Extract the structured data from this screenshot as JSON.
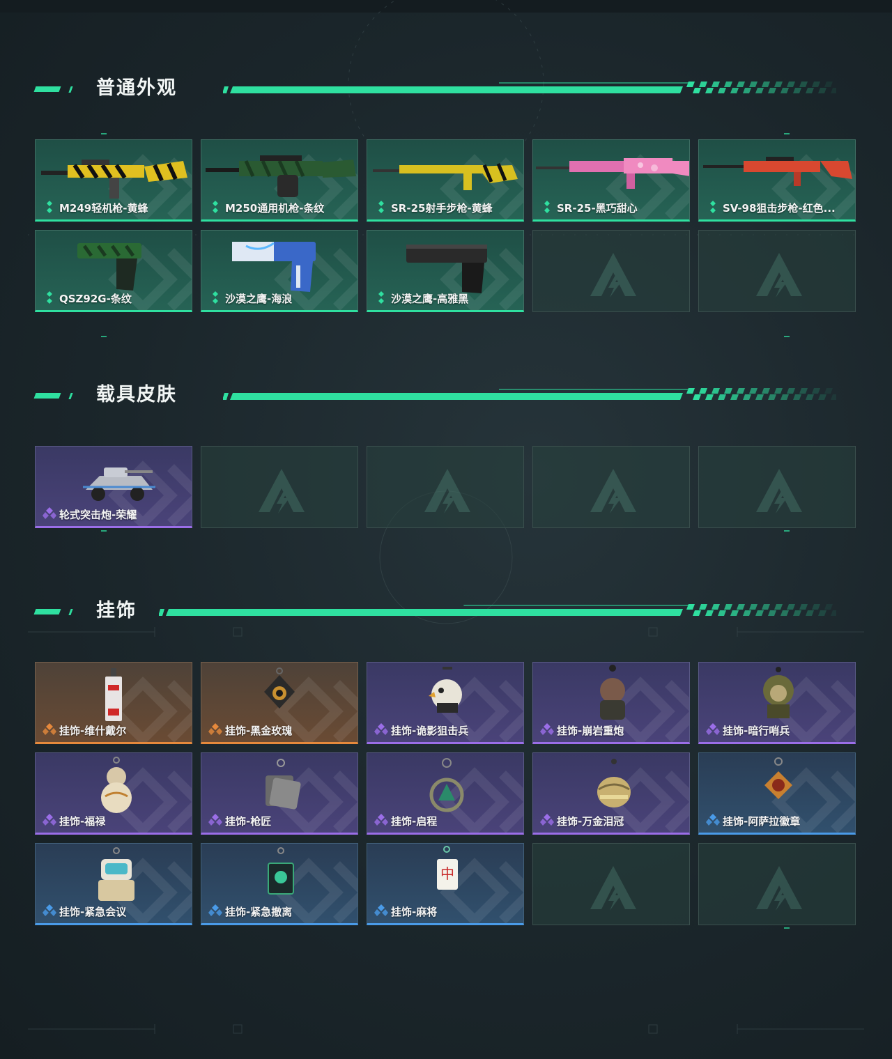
{
  "sections": [
    {
      "title": "普通外观",
      "items": [
        {
          "label": "M249轻机枪-黄蜂",
          "rarity": "green",
          "art": "rifle-yellow"
        },
        {
          "label": "M250通用机枪-条纹",
          "rarity": "green",
          "art": "mg-green"
        },
        {
          "label": "SR-25射手步枪-黄蜂",
          "rarity": "green",
          "art": "rifle-thin-yellow"
        },
        {
          "label": "SR-25-黑巧甜心",
          "rarity": "green",
          "art": "rifle-pink"
        },
        {
          "label": "SV-98狙击步枪-红色...",
          "rarity": "green",
          "art": "sniper-red"
        },
        {
          "label": "QSZ92G-条纹",
          "rarity": "green",
          "art": "pistol-green"
        },
        {
          "label": "沙漠之鹰-海浪",
          "rarity": "green",
          "art": "pistol-blue"
        },
        {
          "label": "沙漠之鹰-高雅黑",
          "rarity": "green",
          "art": "pistol-black"
        },
        {
          "label": "",
          "rarity": "empty"
        },
        {
          "label": "",
          "rarity": "empty"
        }
      ]
    },
    {
      "title": "载具皮肤",
      "items": [
        {
          "label": "轮式突击炮-荣耀",
          "rarity": "purple",
          "art": "vehicle"
        },
        {
          "label": "",
          "rarity": "empty"
        },
        {
          "label": "",
          "rarity": "empty"
        },
        {
          "label": "",
          "rarity": "empty"
        },
        {
          "label": "",
          "rarity": "empty"
        }
      ]
    },
    {
      "title": "挂饰",
      "items": [
        {
          "label": "挂饰-维什戴尔",
          "rarity": "orange",
          "art": "charm-tag"
        },
        {
          "label": "挂饰-黑金玫瑰",
          "rarity": "orange",
          "art": "charm-rose"
        },
        {
          "label": "挂饰-诡影狙击兵",
          "rarity": "purple",
          "art": "charm-bird"
        },
        {
          "label": "挂饰-崩岩重炮",
          "rarity": "purple",
          "art": "charm-figure"
        },
        {
          "label": "挂饰-暗行哨兵",
          "rarity": "purple",
          "art": "charm-ghillie"
        },
        {
          "label": "挂饰-福禄",
          "rarity": "purple",
          "art": "charm-gourd"
        },
        {
          "label": "挂饰-枪匠",
          "rarity": "purple",
          "art": "charm-dogtag"
        },
        {
          "label": "挂饰-启程",
          "rarity": "purple",
          "art": "charm-ring"
        },
        {
          "label": "挂饰-万金泪冠",
          "rarity": "purple",
          "art": "charm-crown"
        },
        {
          "label": "挂饰-阿萨拉徽章",
          "rarity": "blue",
          "art": "charm-badge"
        },
        {
          "label": "挂饰-紧急会议",
          "rarity": "blue",
          "art": "charm-robot"
        },
        {
          "label": "挂饰-紧急撤离",
          "rarity": "blue",
          "art": "charm-box"
        },
        {
          "label": "挂饰-麻将",
          "rarity": "blue",
          "art": "charm-mahjong"
        },
        {
          "label": "",
          "rarity": "empty"
        },
        {
          "label": "",
          "rarity": "empty"
        }
      ]
    }
  ],
  "colors": {
    "accent": "#2fe0a0",
    "green": "#2fe0a0",
    "purple": "#9b6ee8",
    "orange": "#e6893c",
    "blue": "#4a9be8"
  }
}
